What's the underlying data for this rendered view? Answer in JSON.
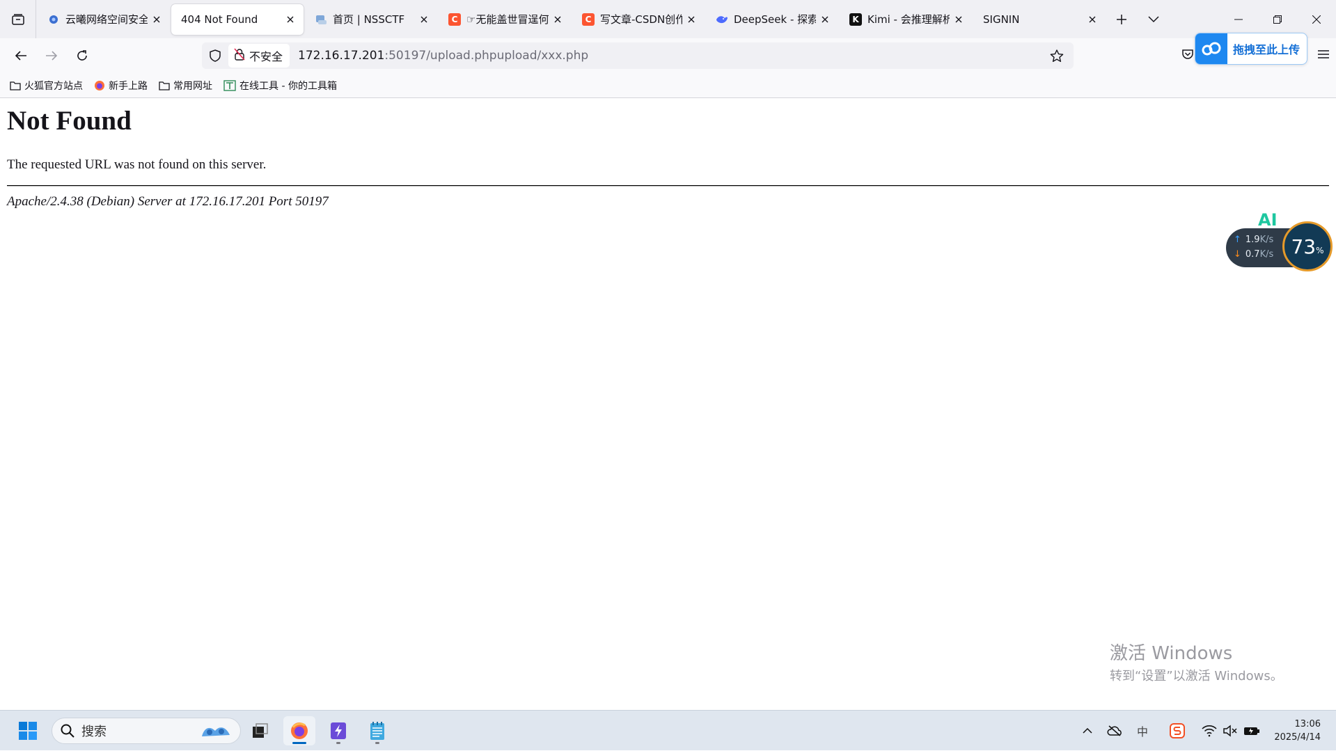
{
  "tabs": [
    {
      "title": "云曦网络空间安全",
      "favicon": "yunxi-icon",
      "active": false
    },
    {
      "title": "404 Not Found",
      "favicon": "",
      "active": true
    },
    {
      "title": "首页 | NSSCTF",
      "favicon": "nssctf-icon",
      "active": false
    },
    {
      "title": "☞无能盖世冒逞何",
      "favicon": "csdn-icon",
      "active": false
    },
    {
      "title": "写文章-CSDN创作",
      "favicon": "csdn-icon",
      "active": false
    },
    {
      "title": "DeepSeek - 探索",
      "favicon": "deepseek-icon",
      "active": false
    },
    {
      "title": "Kimi - 会推理解析",
      "favicon": "kimi-icon",
      "active": false
    },
    {
      "title": "SIGNIN",
      "favicon": "",
      "active": false
    }
  ],
  "urlbar": {
    "security_label": "不安全",
    "host": "172.16.17.201",
    "rest": ":50197/upload.phpupload/xxx.php"
  },
  "upload_button": {
    "label": "拖拽至此上传"
  },
  "bookmarks": [
    {
      "label": "火狐官方站点",
      "icon": "folder-icon"
    },
    {
      "label": "新手上路",
      "icon": "firefox-icon"
    },
    {
      "label": "常用网址",
      "icon": "folder-icon"
    },
    {
      "label": "在线工具 - 你的工具箱",
      "icon": "toolbox-icon"
    }
  ],
  "page": {
    "heading": "Not Found",
    "message": "The requested URL was not found on this server.",
    "address": "Apache/2.4.38 (Debian) Server at 172.16.17.201 Port 50197"
  },
  "net_widget": {
    "ai_label": "AI",
    "upload_speed": "1.9",
    "download_speed": "0.7",
    "speed_unit": "K/s",
    "percent": "73",
    "percent_unit": "%"
  },
  "watermark": {
    "line1": "激活 Windows",
    "line2": "转到“设置”以激活 Windows。"
  },
  "taskbar": {
    "search_placeholder": "搜索",
    "time": "13:06",
    "date": "2025/4/14",
    "ime_label": "中"
  },
  "colors": {
    "accent": "#0067c0",
    "csdn_red": "#fc5531",
    "upload_blue": "#1e88f0"
  }
}
